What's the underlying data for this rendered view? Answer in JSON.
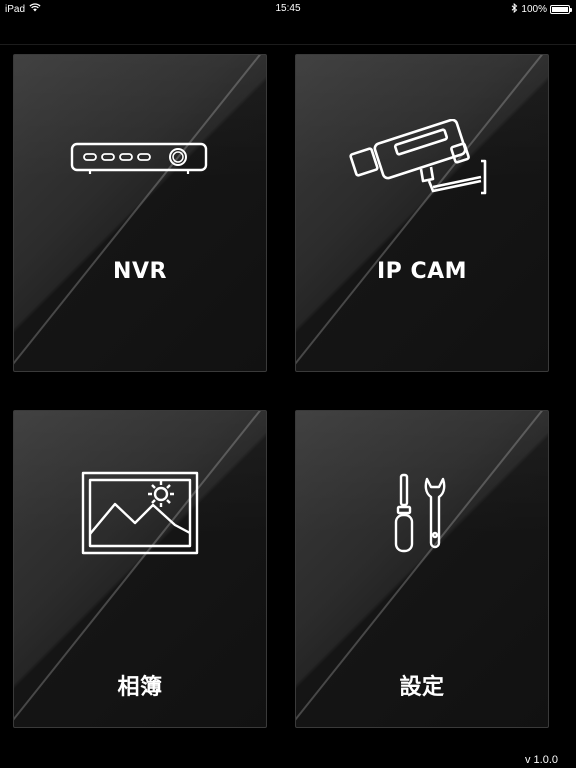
{
  "status_bar": {
    "device": "iPad",
    "time": "15:45",
    "battery": "100%",
    "battery_level": 1.0,
    "icons": [
      "wifi-icon",
      "bluetooth-icon",
      "battery-icon"
    ]
  },
  "tiles": [
    {
      "id": "nvr",
      "label": "NVR",
      "icon": "nvr-recorder-icon"
    },
    {
      "id": "ipcam",
      "label": "IP CAM",
      "icon": "security-camera-icon"
    },
    {
      "id": "album",
      "label": "相簿",
      "icon": "picture-icon"
    },
    {
      "id": "settings",
      "label": "設定",
      "icon": "tools-icon"
    }
  ],
  "version": "v 1.0.0",
  "colors": {
    "background": "#000000",
    "tile_light": "#3a3a3a",
    "tile_dark": "#111111",
    "text": "#ffffff"
  }
}
